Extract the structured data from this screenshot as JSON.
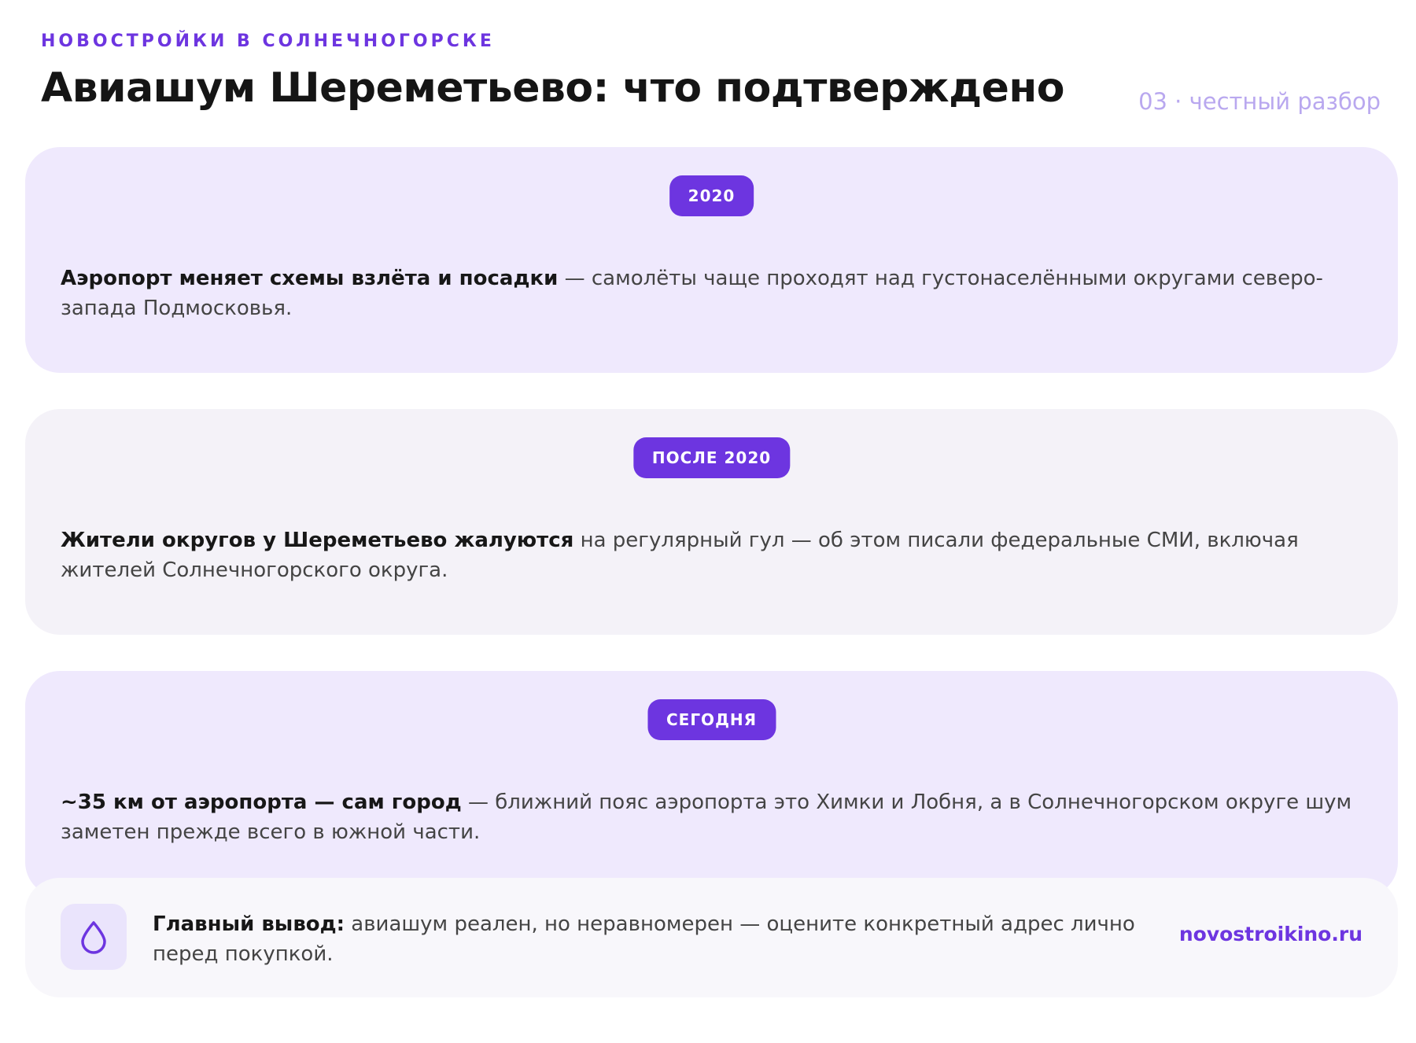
{
  "header": {
    "eyebrow": "НОВОСТРОЙКИ В СОЛНЕЧНОГОРСКЕ",
    "title": "Авиашум Шереметьево: что подтверждено",
    "page_label": "03 · честный разбор"
  },
  "timeline": [
    {
      "badge": "2020",
      "bold": "Аэропорт меняет схемы взлёта и посадки",
      "text": " — самолёты чаще проходят над густонаселёнными округами северо-запада Подмосковья."
    },
    {
      "badge": "ПОСЛЕ 2020",
      "bold": "Жители округов у Шереметьево жалуются",
      "text": " на регулярный гул — об этом писали федеральные СМИ, включая жителей Солнечногорского округа."
    },
    {
      "badge": "СЕГОДНЯ",
      "bold": "~35 км от аэропорта — сам город",
      "text": " — ближний пояс аэропорта это Химки и Лобня, а в Солнечногорском округе шум заметен прежде всего в южной части."
    }
  ],
  "summary": {
    "icon": "drop-icon",
    "bold": "Главный вывод:",
    "text": " авиашум реален, но неравномерен — оцените конкретный адрес лично перед покупкой.",
    "site": "novostroikino.ru"
  },
  "colors": {
    "accent": "#6d35e0",
    "card_purple": "#efe9fd",
    "card_gray": "#f4f2f8",
    "page_label": "#b9a8ef"
  }
}
